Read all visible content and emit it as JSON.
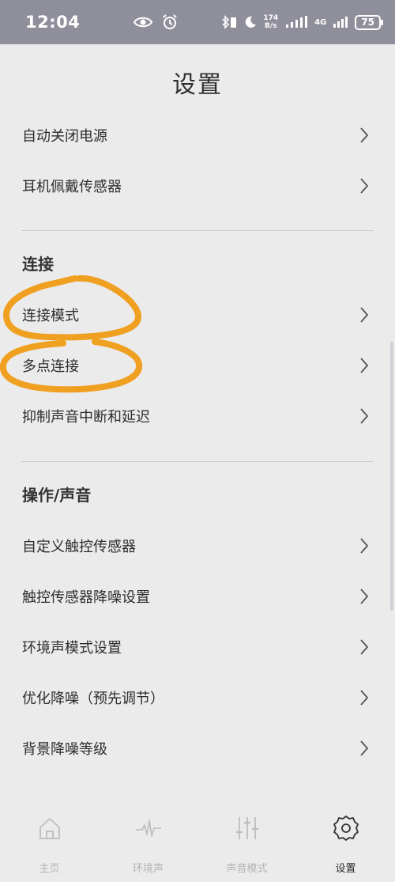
{
  "status_bar": {
    "time": "12:04",
    "net_speed_value": "174",
    "net_speed_unit": "B/s",
    "network": "4G",
    "battery": "75"
  },
  "title": "设置",
  "rows_top": [
    {
      "label": "自动关闭电源"
    },
    {
      "label": "耳机佩戴传感器"
    }
  ],
  "section_connection": {
    "header": "连接",
    "items": [
      {
        "label": "连接模式"
      },
      {
        "label": "多点连接"
      },
      {
        "label": "抑制声音中断和延迟"
      }
    ]
  },
  "section_operation": {
    "header": "操作/声音",
    "items": [
      {
        "label": "自定义触控传感器"
      },
      {
        "label": "触控传感器降噪设置"
      },
      {
        "label": "环境声模式设置"
      },
      {
        "label": "优化降噪（预先调节）"
      },
      {
        "label": "背景降噪等级"
      }
    ]
  },
  "bottom_nav": [
    {
      "label": "主页",
      "icon": "home-icon",
      "active": false
    },
    {
      "label": "环境声",
      "icon": "ambient-wave-icon",
      "active": false
    },
    {
      "label": "声音模式",
      "icon": "equalizer-icon",
      "active": false
    },
    {
      "label": "设置",
      "icon": "gear-icon",
      "active": true
    }
  ],
  "colors": {
    "status_bar": "#8f8f9b",
    "background": "#ebebeb",
    "annotation": "#f0a020",
    "inactive_nav": "#b3b3b3"
  }
}
